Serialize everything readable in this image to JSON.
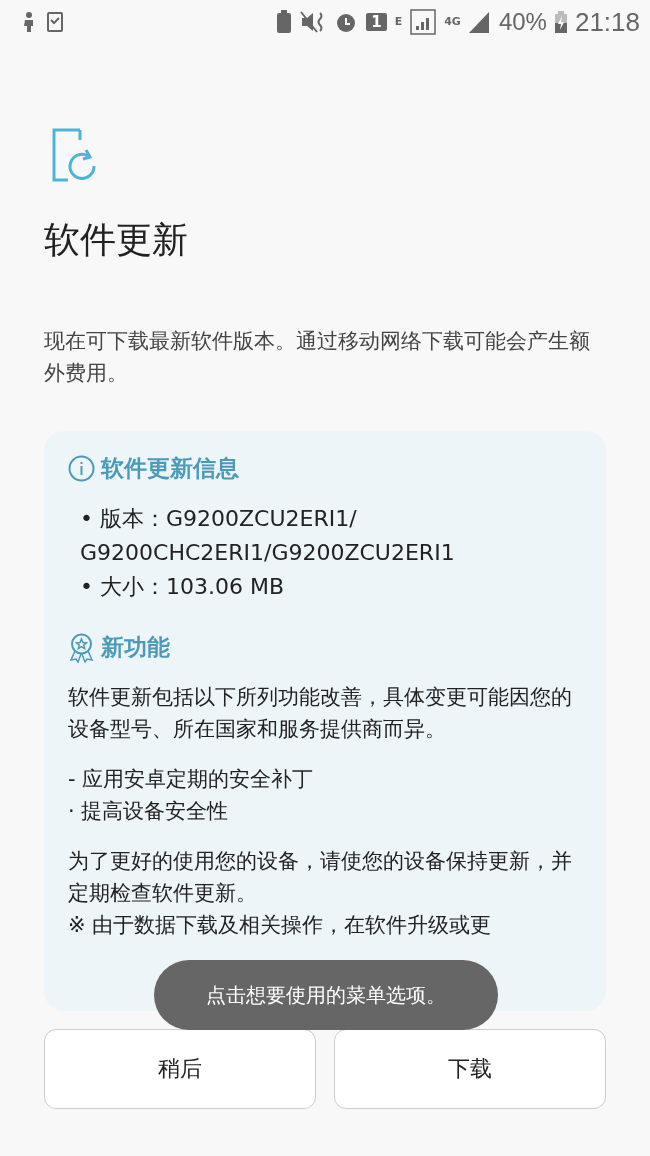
{
  "status_bar": {
    "battery_percent": "40%",
    "time": "21:18",
    "network_e": "E",
    "network_4g": "4G",
    "sim_slot": "1"
  },
  "title": "软件更新",
  "description": "现在可下载最新软件版本。通过移动网络下载可能会产生额外费用。",
  "info": {
    "heading": "软件更新信息",
    "items": [
      "• 版本：G9200ZCU2ERI1/ G9200CHC2ERI1/G9200ZCU2ERI1",
      "• 大小：103.06 MB"
    ]
  },
  "features": {
    "heading": "新功能",
    "paragraphs": [
      "软件更新包括以下所列功能改善，具体变更可能因您的设备型号、所在国家和服务提供商而异。",
      "- 应用安卓定期的安全补丁\n · 提高设备安全性",
      "为了更好的使用您的设备，请使您的设备保持更新，并定期检查软件更新。\n※ 由于数据下载及相关操作，在软件升级或更"
    ]
  },
  "toast": "点击想要使用的菜单选项。",
  "buttons": [
    {
      "label": "稍后"
    },
    {
      "label": "下载"
    }
  ]
}
